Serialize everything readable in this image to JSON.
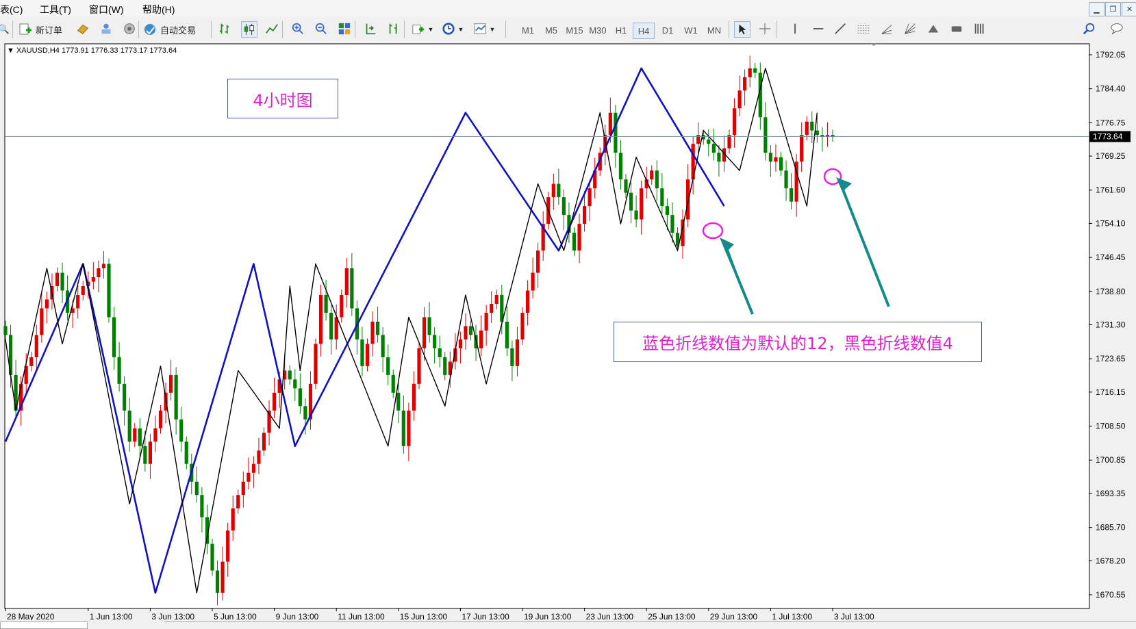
{
  "menu": [
    "表(C)",
    "工具(T)",
    "窗口(W)",
    "帮助(H)"
  ],
  "toolbar": {
    "new_order": "新订单",
    "auto_trading": "自动交易",
    "timeframes": [
      "M1",
      "M5",
      "M15",
      "M30",
      "H1",
      "H4",
      "D1",
      "W1",
      "MN"
    ],
    "active_timeframe": "H4"
  },
  "chart": {
    "header": "XAUUSD,H4  1773.91 1776.33 1773.17 1773.64",
    "current_price": "1773.64",
    "title_box": "4小时图",
    "note_box": "蓝色折线数值为默认的12，黑色折线数值4"
  },
  "chart_data": {
    "type": "candlestick",
    "symbol": "XAUUSD",
    "timeframe": "H4",
    "ohlc_header": {
      "open": 1773.91,
      "high": 1776.33,
      "low": 1773.17,
      "close": 1773.64
    },
    "current_price": 1773.64,
    "y_ticks": [
      "1792.05",
      "1784.40",
      "1776.75",
      "1769.25",
      "1761.60",
      "1754.10",
      "1746.45",
      "1738.80",
      "1731.30",
      "1723.65",
      "1716.15",
      "1708.50",
      "1700.85",
      "1693.35",
      "1685.70",
      "1678.20",
      "1670.55"
    ],
    "ylim": [
      1668.5,
      1794.5
    ],
    "x_ticks": [
      {
        "label": "28 May 2020",
        "bar": 0
      },
      {
        "label": "1 Jun 13:00",
        "bar": 16
      },
      {
        "label": "3 Jun 13:00",
        "bar": 28
      },
      {
        "label": "5 Jun 13:00",
        "bar": 40
      },
      {
        "label": "9 Jun 13:00",
        "bar": 52
      },
      {
        "label": "11 Jun 13:00",
        "bar": 64
      },
      {
        "label": "15 Jun 13:00",
        "bar": 76
      },
      {
        "label": "17 Jun 13:00",
        "bar": 88
      },
      {
        "label": "19 Jun 13:00",
        "bar": 100
      },
      {
        "label": "23 Jun 13:00",
        "bar": 112
      },
      {
        "label": "25 Jun 13:00",
        "bar": 124
      },
      {
        "label": "29 Jun 13:00",
        "bar": 136
      },
      {
        "label": "1 Jul 13:00",
        "bar": 148
      },
      {
        "label": "3 Jul 13:00",
        "bar": 160
      }
    ],
    "closes": [
      1729,
      1720,
      1712,
      1718,
      1722,
      1724,
      1729,
      1735,
      1737,
      1740,
      1743,
      1739,
      1734,
      1735,
      1738,
      1740,
      1741,
      1742,
      1744,
      1745,
      1733,
      1724,
      1718,
      1712,
      1705,
      1708,
      1704,
      1700,
      1705,
      1708,
      1712,
      1716,
      1720,
      1710,
      1705,
      1700,
      1696,
      1693,
      1688,
      1682,
      1676,
      1671,
      1678,
      1685,
      1690,
      1693,
      1696,
      1698,
      1700,
      1703,
      1707,
      1712,
      1716,
      1719,
      1721,
      1719,
      1717,
      1713,
      1710,
      1718,
      1727,
      1738,
      1734,
      1728,
      1733,
      1738,
      1744,
      1735,
      1728,
      1722,
      1727,
      1732,
      1729,
      1724,
      1720,
      1716,
      1712,
      1704,
      1712,
      1718,
      1726,
      1733,
      1729,
      1726,
      1724,
      1720,
      1723,
      1726,
      1728,
      1731,
      1729,
      1726,
      1730,
      1734,
      1736,
      1738,
      1732,
      1726,
      1722,
      1728,
      1734,
      1739,
      1743,
      1748,
      1754,
      1760,
      1763,
      1760,
      1756,
      1752,
      1748,
      1754,
      1758,
      1762,
      1766,
      1770,
      1774,
      1779,
      1770,
      1764,
      1761,
      1757,
      1755,
      1762,
      1764,
      1766,
      1762,
      1758,
      1756,
      1752,
      1749,
      1755,
      1764,
      1772,
      1774,
      1773,
      1772,
      1770,
      1768,
      1771,
      1774,
      1780,
      1784,
      1787,
      1789,
      1788,
      1778,
      1770,
      1768,
      1769,
      1766,
      1762,
      1759,
      1768,
      1774,
      1777,
      1775,
      1774,
      1773.64,
      1774,
      1773.64
    ],
    "zigzag_default_12": {
      "color": "#1010c8",
      "points": [
        {
          "bar": 0,
          "value": 1705
        },
        {
          "bar": 15,
          "value": 1745
        },
        {
          "bar": 29,
          "value": 1671
        },
        {
          "bar": 48,
          "value": 1745
        },
        {
          "bar": 56,
          "value": 1704
        },
        {
          "bar": 89,
          "value": 1779
        },
        {
          "bar": 107,
          "value": 1748
        },
        {
          "bar": 123,
          "value": 1789
        },
        {
          "bar": 139,
          "value": 1758
        }
      ]
    },
    "zigzag_4": {
      "color": "#000000",
      "points": [
        {
          "bar": 0,
          "value": 1728
        },
        {
          "bar": 2,
          "value": 1712
        },
        {
          "bar": 8,
          "value": 1744
        },
        {
          "bar": 11,
          "value": 1727
        },
        {
          "bar": 15,
          "value": 1745
        },
        {
          "bar": 24,
          "value": 1691
        },
        {
          "bar": 30,
          "value": 1722
        },
        {
          "bar": 37,
          "value": 1671
        },
        {
          "bar": 45,
          "value": 1721
        },
        {
          "bar": 53,
          "value": 1708
        },
        {
          "bar": 55,
          "value": 1740
        },
        {
          "bar": 57,
          "value": 1721
        },
        {
          "bar": 60,
          "value": 1745
        },
        {
          "bar": 74,
          "value": 1704
        },
        {
          "bar": 78,
          "value": 1733
        },
        {
          "bar": 85,
          "value": 1713
        },
        {
          "bar": 89,
          "value": 1738
        },
        {
          "bar": 93,
          "value": 1718
        },
        {
          "bar": 103,
          "value": 1763
        },
        {
          "bar": 108,
          "value": 1748
        },
        {
          "bar": 115,
          "value": 1779
        },
        {
          "bar": 119,
          "value": 1754
        },
        {
          "bar": 122,
          "value": 1769
        },
        {
          "bar": 130,
          "value": 1748
        },
        {
          "bar": 135,
          "value": 1775
        },
        {
          "bar": 142,
          "value": 1766
        },
        {
          "bar": 147,
          "value": 1789
        },
        {
          "bar": 155,
          "value": 1758
        },
        {
          "bar": 157,
          "value": 1779
        }
      ]
    },
    "grid": false
  }
}
